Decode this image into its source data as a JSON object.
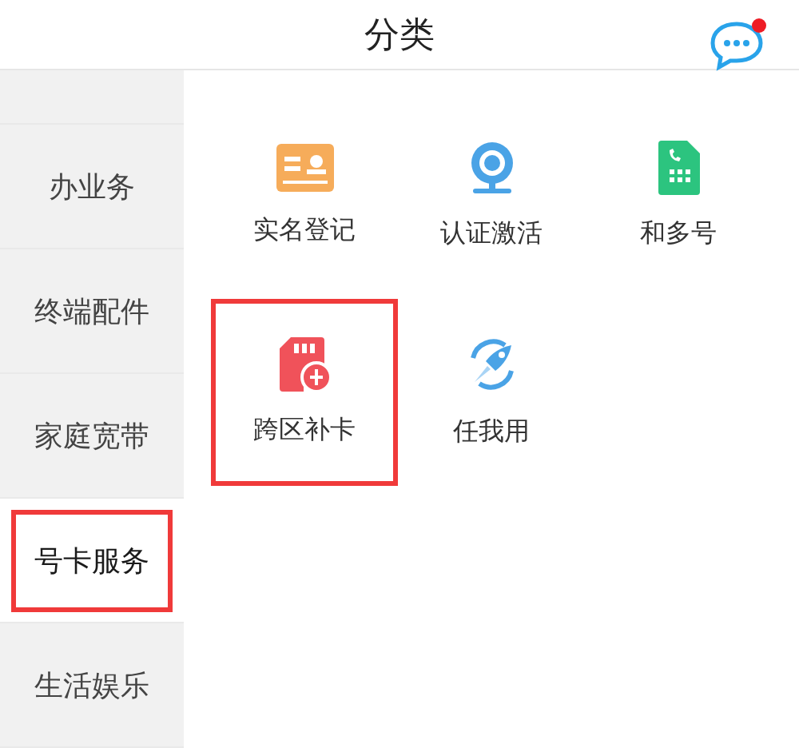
{
  "header": {
    "title": "分类",
    "notification_dot": true
  },
  "sidebar": {
    "items": [
      {
        "label": "办业务",
        "selected": false,
        "highlighted": false
      },
      {
        "label": "终端配件",
        "selected": false,
        "highlighted": false
      },
      {
        "label": "家庭宽带",
        "selected": false,
        "highlighted": false
      },
      {
        "label": "号卡服务",
        "selected": true,
        "highlighted": true
      },
      {
        "label": "生活娱乐",
        "selected": false,
        "highlighted": false
      }
    ]
  },
  "services": [
    {
      "label": "实名登记",
      "kind": "idcard",
      "highlighted": false
    },
    {
      "label": "认证激活",
      "kind": "webcam",
      "highlighted": false
    },
    {
      "label": "和多号",
      "kind": "simphone",
      "highlighted": false
    },
    {
      "label": "跨区补卡",
      "kind": "simcard",
      "highlighted": true
    },
    {
      "label": "任我用",
      "kind": "rocket",
      "highlighted": false
    }
  ]
}
